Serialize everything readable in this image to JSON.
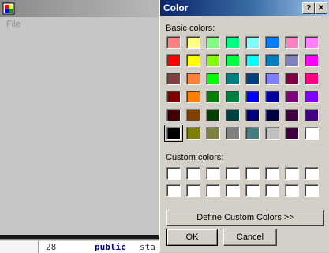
{
  "background_app": {
    "menu": {
      "file": "File"
    },
    "editor": {
      "line_number": "28",
      "keyword": "public",
      "rest": "sta"
    }
  },
  "dialog": {
    "title": "Color",
    "help_label": "?",
    "close_label": "✕",
    "basic_colors_label": "Basic colors:",
    "custom_colors_label": "Custom colors:",
    "define_button_label": "Define Custom Colors >>",
    "ok_label": "OK",
    "cancel_label": "Cancel",
    "selected_basic_color": "#000000",
    "basic_colors": [
      [
        "#ff8080",
        "#ffff80",
        "#80ff80",
        "#00ff80",
        "#80ffff",
        "#0080ff",
        "#ff80c0",
        "#ff80ff"
      ],
      [
        "#ff0000",
        "#ffff00",
        "#80ff00",
        "#00ff40",
        "#00ffff",
        "#0080c0",
        "#8080c0",
        "#ff00ff"
      ],
      [
        "#804040",
        "#ff8040",
        "#00ff00",
        "#008080",
        "#004080",
        "#8080ff",
        "#800040",
        "#ff0080"
      ],
      [
        "#800000",
        "#ff8000",
        "#008000",
        "#008040",
        "#0000ff",
        "#0000a0",
        "#800080",
        "#8000ff"
      ],
      [
        "#400000",
        "#804000",
        "#004000",
        "#004040",
        "#000080",
        "#000040",
        "#400040",
        "#400080"
      ],
      [
        "#000000",
        "#808000",
        "#808040",
        "#808080",
        "#408080",
        "#c0c0c0",
        "#400040",
        "#ffffff"
      ]
    ],
    "custom_colors": [
      [
        "#ffffff",
        "#ffffff",
        "#ffffff",
        "#ffffff",
        "#ffffff",
        "#ffffff",
        "#ffffff",
        "#ffffff"
      ],
      [
        "#ffffff",
        "#ffffff",
        "#ffffff",
        "#ffffff",
        "#ffffff",
        "#ffffff",
        "#ffffff",
        "#ffffff"
      ]
    ]
  }
}
